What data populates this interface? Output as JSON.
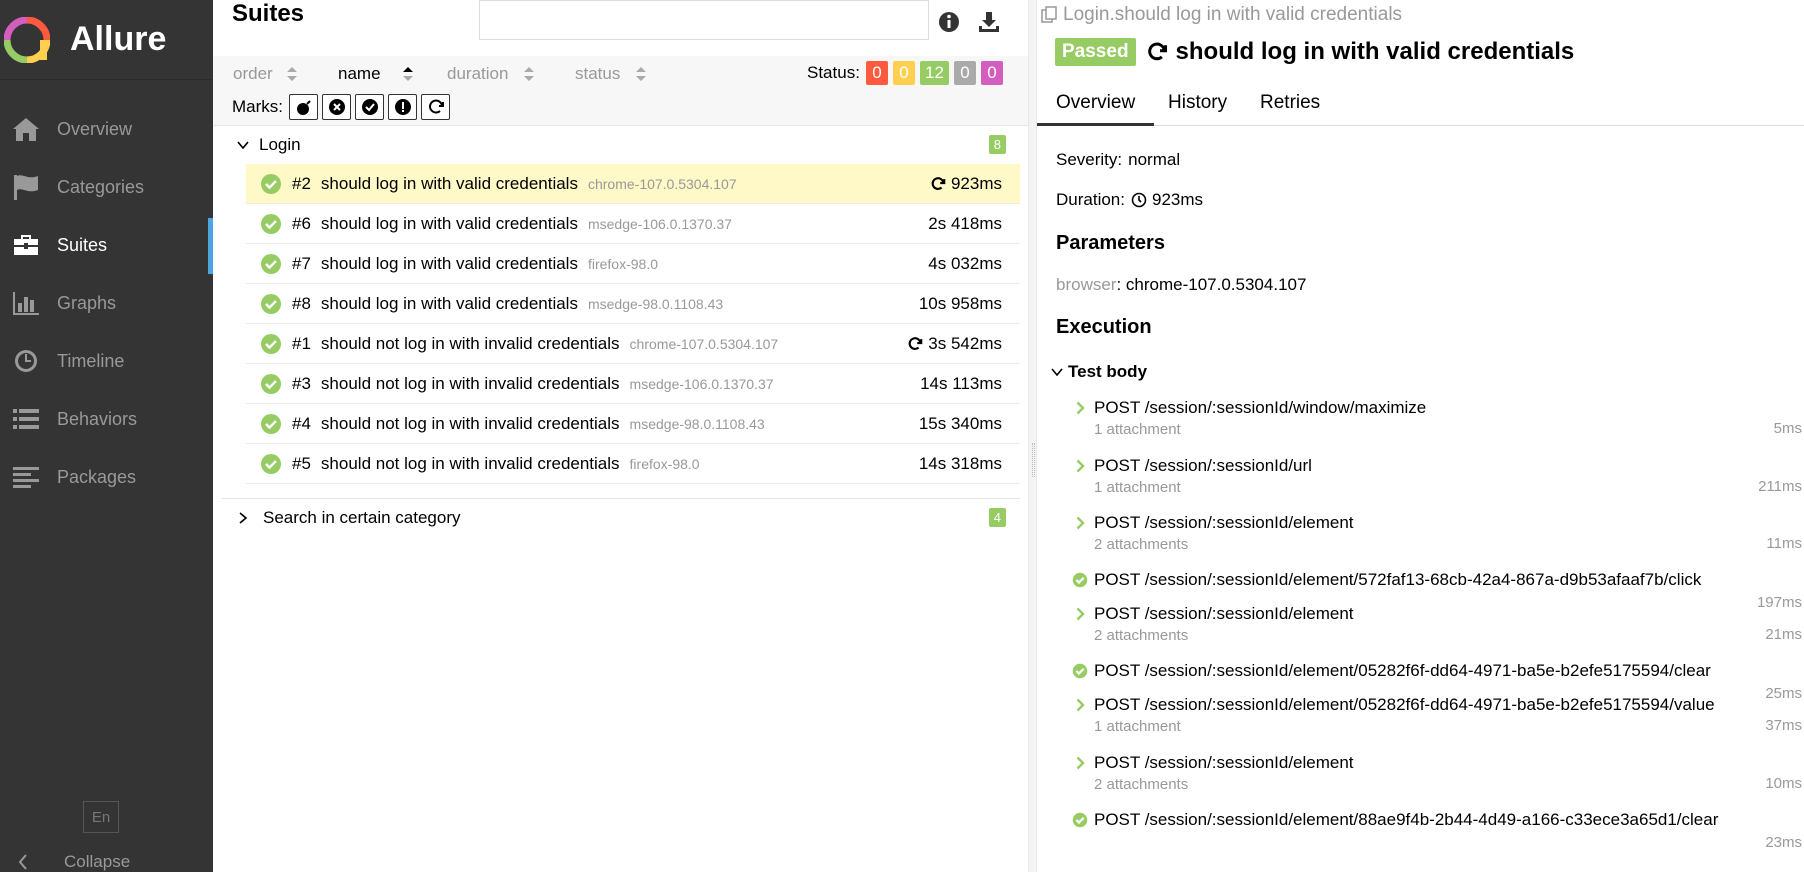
{
  "sidebar": {
    "brand": "Allure",
    "items": [
      {
        "label": "Overview",
        "icon": "home-icon"
      },
      {
        "label": "Categories",
        "icon": "flag-icon"
      },
      {
        "label": "Suites",
        "icon": "briefcase-icon",
        "active": true
      },
      {
        "label": "Graphs",
        "icon": "bar-chart-icon"
      },
      {
        "label": "Timeline",
        "icon": "clock-icon"
      },
      {
        "label": "Behaviors",
        "icon": "list-icon"
      },
      {
        "label": "Packages",
        "icon": "align-left-icon"
      }
    ],
    "language": "En",
    "collapse_label": "Collapse"
  },
  "suites": {
    "title": "Suites",
    "search_value": "",
    "sort": [
      {
        "label": "order",
        "active": false
      },
      {
        "label": "name",
        "active": true
      },
      {
        "label": "duration",
        "active": false
      },
      {
        "label": "status",
        "active": false
      }
    ],
    "status_label": "Status:",
    "status_counts": [
      {
        "value": "0",
        "color": "#fd5a3e"
      },
      {
        "value": "0",
        "color": "#ffd050"
      },
      {
        "value": "12",
        "color": "#97cc64"
      },
      {
        "value": "0",
        "color": "#aaaaaa"
      },
      {
        "value": "0",
        "color": "#d35ebe"
      }
    ],
    "marks_label": "Marks:",
    "marks": [
      "bomb-icon",
      "times-circle-icon",
      "check-circle-icon",
      "exclamation-circle-icon",
      "refresh-icon"
    ],
    "groups": [
      {
        "name": "Login",
        "count": "8",
        "expanded": true,
        "rows": [
          {
            "num": "#2",
            "name": "should log in with valid credentials",
            "param": "chrome-107.0.5304.107",
            "duration": "923ms",
            "retried": true,
            "selected": true
          },
          {
            "num": "#6",
            "name": "should log in with valid credentials",
            "param": "msedge-106.0.1370.37",
            "duration": "2s 418ms"
          },
          {
            "num": "#7",
            "name": "should log in with valid credentials",
            "param": "firefox-98.0",
            "duration": "4s 032ms"
          },
          {
            "num": "#8",
            "name": "should log in with valid credentials",
            "param": "msedge-98.0.1108.43",
            "duration": "10s 958ms"
          },
          {
            "num": "#1",
            "name": "should not log in with invalid credentials",
            "param": "chrome-107.0.5304.107",
            "duration": "3s 542ms",
            "retried": true
          },
          {
            "num": "#3",
            "name": "should not log in with invalid credentials",
            "param": "msedge-106.0.1370.37",
            "duration": "14s 113ms"
          },
          {
            "num": "#4",
            "name": "should not log in with invalid credentials",
            "param": "msedge-98.0.1108.43",
            "duration": "15s 340ms"
          },
          {
            "num": "#5",
            "name": "should not log in with invalid credentials",
            "param": "firefox-98.0",
            "duration": "14s 318ms"
          }
        ]
      },
      {
        "name": "Search in certain category",
        "count": "4",
        "expanded": false
      }
    ]
  },
  "detail": {
    "breadcrumb": "Login.should log in with valid credentials",
    "status": "Passed",
    "title": "should log in with valid credentials",
    "tabs": [
      "Overview",
      "History",
      "Retries"
    ],
    "severity": {
      "label": "Severity:",
      "value": "normal"
    },
    "duration": {
      "label": "Duration:",
      "value": "923ms"
    },
    "parameters_title": "Parameters",
    "parameter": {
      "key": "browser",
      "value": ": chrome-107.0.5304.107"
    },
    "execution_title": "Execution",
    "test_body_label": "Test body",
    "steps": [
      {
        "label": "POST /session/:sessionId/window/maximize",
        "sub": "1 attachment",
        "duration": "5ms",
        "expandable": true
      },
      {
        "label": "POST /session/:sessionId/url",
        "sub": "1 attachment",
        "duration": "211ms",
        "expandable": true
      },
      {
        "label": "POST /session/:sessionId/element",
        "sub": "2 attachments",
        "duration": "11ms",
        "expandable": true
      },
      {
        "label": "POST /session/:sessionId/element/572faf13-68cb-42a4-867a-d9b53afaaf7b/click",
        "sub": "",
        "duration": "197ms",
        "expandable": false
      },
      {
        "label": "POST /session/:sessionId/element",
        "sub": "2 attachments",
        "duration": "21ms",
        "expandable": true
      },
      {
        "label": "POST /session/:sessionId/element/05282f6f-dd64-4971-ba5e-b2efe5175594/clear",
        "sub": "",
        "duration": "25ms",
        "expandable": false
      },
      {
        "label": "POST /session/:sessionId/element/05282f6f-dd64-4971-ba5e-b2efe5175594/value",
        "sub": "1 attachment",
        "duration": "37ms",
        "expandable": true
      },
      {
        "label": "POST /session/:sessionId/element",
        "sub": "2 attachments",
        "duration": "10ms",
        "expandable": true
      },
      {
        "label": "POST /session/:sessionId/element/88ae9f4b-2b44-4d49-a166-c33ece3a65d1/clear",
        "sub": "",
        "duration": "23ms",
        "expandable": false
      }
    ]
  }
}
